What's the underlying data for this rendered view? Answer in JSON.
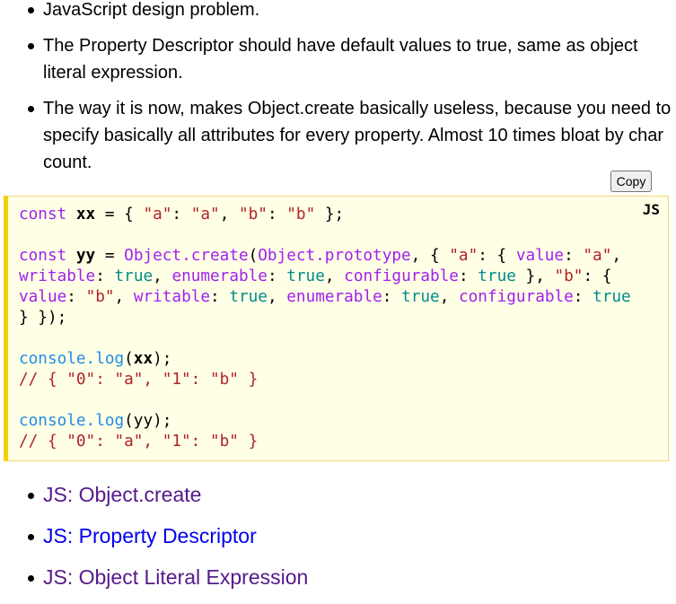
{
  "intro_list": [
    "JavaScript design problem.",
    "The Property Descriptor should have default values to true, same as object literal expression.",
    "The way it is now, makes Object.create basically useless, because you need to specify basically all attributes for every property. Almost 10 times bloat by char count."
  ],
  "copy_button": "Copy",
  "code_lang": "JS",
  "code": {
    "const_kw": "const",
    "var_xx": "xx",
    "var_yy": "yy",
    "object_create": "Object.create",
    "object_prototype": "Object.prototype",
    "prop_value": "value",
    "prop_writable": "writable",
    "prop_enumerable": "enumerable",
    "prop_configurable": "configurable",
    "true_kw": "true",
    "console_log": "console.log",
    "str_a": "\"a\"",
    "str_b": "\"b\"",
    "comment": "// { \"0\": \"a\", \"1\": \"b\" }"
  },
  "related_links": [
    {
      "prefix": "JS: ",
      "label": "Object.create"
    },
    {
      "prefix": "JS: ",
      "label": "Property Descriptor"
    },
    {
      "prefix": "JS: ",
      "label": "Object Literal Expression"
    }
  ]
}
